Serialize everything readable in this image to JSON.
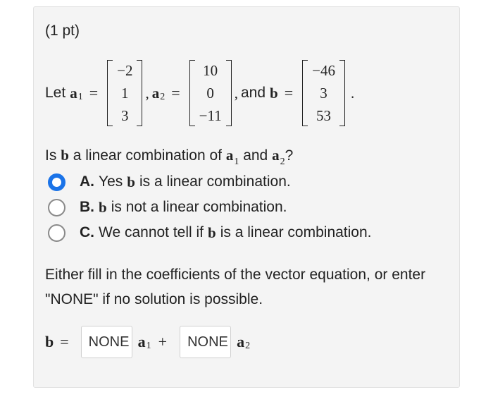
{
  "points": "(1 pt)",
  "problem": {
    "let_text": "Let",
    "a1_symbol": "a",
    "a1_sub": "1",
    "a2_symbol": "a",
    "a2_sub": "2",
    "b_symbol": "b",
    "equals": "=",
    "and_text": "and",
    "comma": ",",
    "period": ".",
    "a1": [
      "−2",
      "1",
      "3"
    ],
    "a2": [
      "10",
      "0",
      "−11"
    ],
    "b": [
      "−46",
      "3",
      "53"
    ]
  },
  "question": {
    "prefix": "Is",
    "middle": "a linear combination of",
    "and": "and",
    "suffix": "?"
  },
  "options": [
    {
      "letter": "A.",
      "before": "Yes",
      "after": "is a linear combination.",
      "selected": true
    },
    {
      "letter": "B.",
      "before": "",
      "after": "is not a linear combination.",
      "selected": false
    },
    {
      "letter": "C.",
      "before": "We cannot tell if",
      "after": "is a linear combination.",
      "selected": false
    }
  ],
  "instructions": "Either fill in the coefficients of the vector equation, or enter \"NONE\" if no solution is possible.",
  "answer": {
    "b_symbol": "b",
    "equals": "=",
    "coef1_value": "NONE",
    "plus": "+",
    "coef2_value": "NONE"
  },
  "colors": {
    "accent": "#1a73e8",
    "card_bg": "#f4f4f4"
  }
}
